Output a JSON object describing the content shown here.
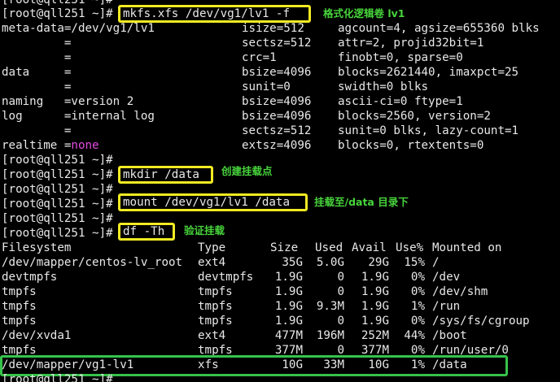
{
  "terminal": {
    "prompt": "[root@qll251 ~]#",
    "commands": [
      "mkfs.xfs /dev/vg1/lv1 -f",
      "mkdir /data",
      "mount /dev/vg1/lv1 /data",
      "df -Th"
    ],
    "annotations": [
      "格式化逻辑卷 lv1",
      "创建挂载点",
      "挂载至/data 目录下",
      "验证挂载"
    ],
    "mkfs_output": [
      [
        "meta-data=/dev/vg1/lv1",
        "isize=512",
        "agcount=4, agsize=655360 blks"
      ],
      [
        "         =",
        "sectsz=512",
        "attr=2, projid32bit=1"
      ],
      [
        "         =",
        "crc=1",
        "finobt=0, sparse=0"
      ],
      [
        "data     =",
        "bsize=4096",
        "blocks=2621440, imaxpct=25"
      ],
      [
        "         =",
        "sunit=0",
        "swidth=0 blks"
      ],
      [
        "naming   =version 2",
        "bsize=4096",
        "ascii-ci=0 ftype=1"
      ],
      [
        "log      =internal log",
        "bsize=4096",
        "blocks=2560, version=2"
      ],
      [
        "         =",
        "sectsz=512",
        "sunit=0 blks, lazy-count=1"
      ],
      [
        "realtime =",
        "extsz=4096",
        "blocks=0, rtextents=0"
      ]
    ],
    "realtime_value": "none",
    "df_header": [
      "Filesystem",
      "Type",
      "Size",
      "Used",
      "Avail",
      "Use%",
      "Mounted on"
    ],
    "df_rows": [
      [
        "/dev/mapper/centos-lv_root",
        "ext4",
        "35G",
        "5.0G",
        "29G",
        "15%",
        "/"
      ],
      [
        "devtmpfs",
        "devtmpfs",
        "1.9G",
        "0",
        "1.9G",
        "0%",
        "/dev"
      ],
      [
        "tmpfs",
        "tmpfs",
        "1.9G",
        "0",
        "1.9G",
        "0%",
        "/dev/shm"
      ],
      [
        "tmpfs",
        "tmpfs",
        "1.9G",
        "9.3M",
        "1.9G",
        "1%",
        "/run"
      ],
      [
        "tmpfs",
        "tmpfs",
        "1.9G",
        "0",
        "1.9G",
        "0%",
        "/sys/fs/cgroup"
      ],
      [
        "/dev/xvda1",
        "ext4",
        "477M",
        "196M",
        "252M",
        "44%",
        "/boot"
      ],
      [
        "tmpfs",
        "tmpfs",
        "377M",
        "0",
        "377M",
        "0%",
        "/run/user/0"
      ],
      [
        "/dev/mapper/vg1-lv1",
        "xfs",
        "10G",
        "33M",
        "10G",
        "1%",
        "/data"
      ]
    ],
    "colors": {
      "command_box": "#f2ea22",
      "annotation": "#47d43b",
      "highlight_row_box": "#36c24a",
      "none_keyword": "#e34ce3"
    }
  }
}
